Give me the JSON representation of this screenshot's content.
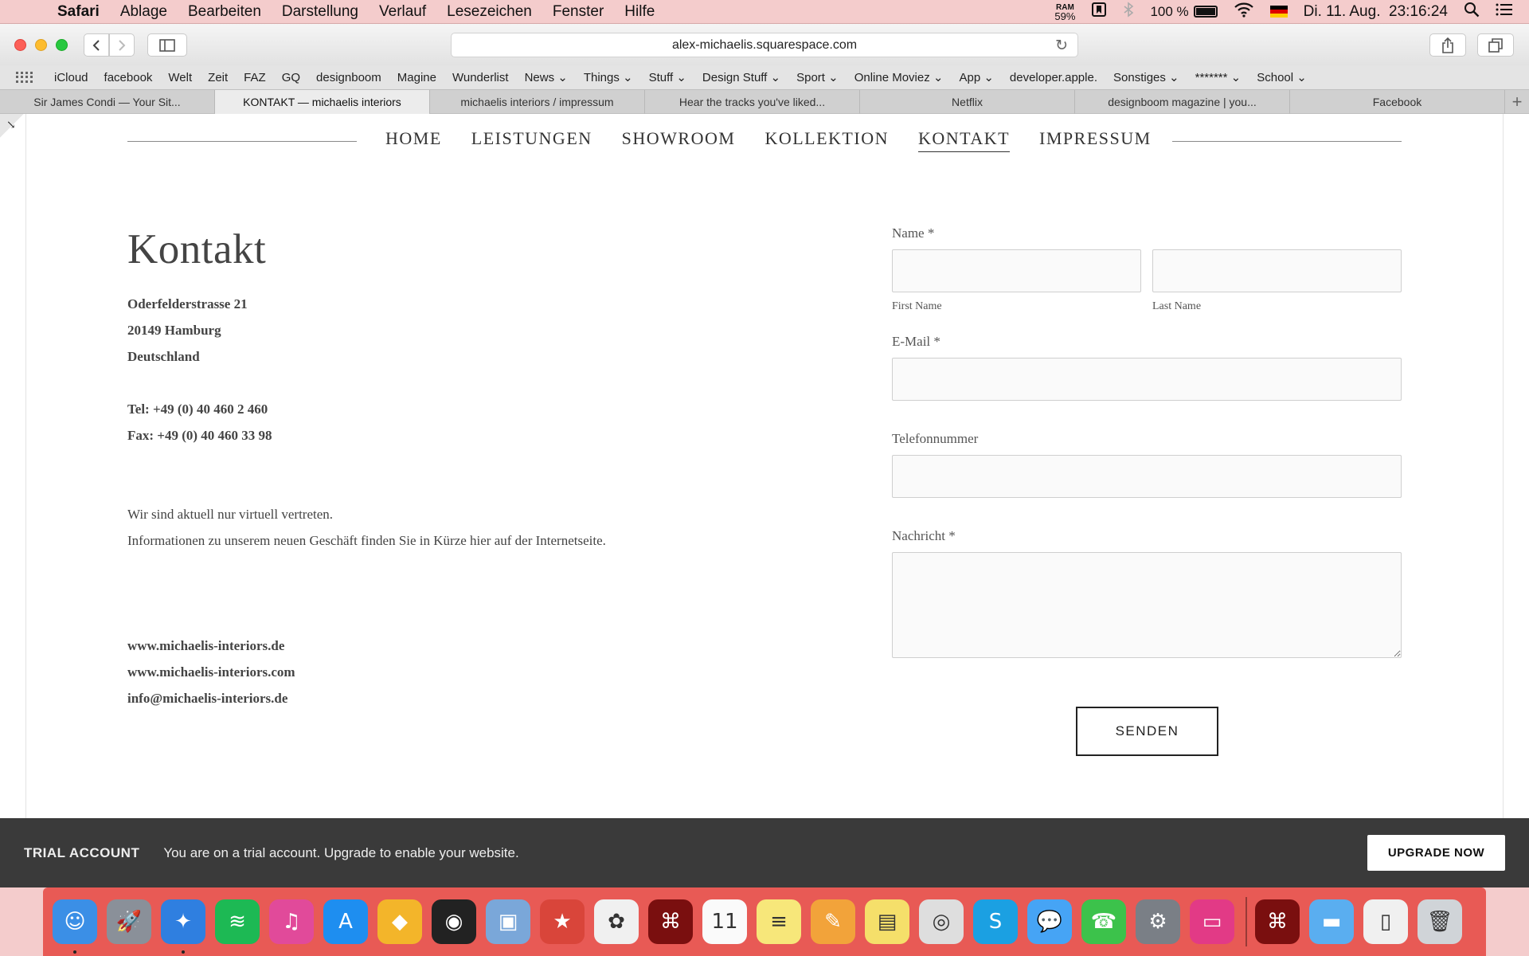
{
  "menubar": {
    "app": "Safari",
    "items": [
      "Ablage",
      "Bearbeiten",
      "Darstellung",
      "Verlauf",
      "Lesezeichen",
      "Fenster",
      "Hilfe"
    ],
    "ram_label": "RAM",
    "ram_value": "59%",
    "battery": "100 %",
    "datetime": "Di. 11. Aug.  23:16:24"
  },
  "toolbar": {
    "url": "alex-michaelis.squarespace.com"
  },
  "bookmarks": [
    "iCloud",
    "facebook",
    "Welt",
    "Zeit",
    "FAZ",
    "GQ",
    "designboom",
    "Magine",
    "Wunderlist",
    "News ⌄",
    "Things ⌄",
    "Stuff ⌄",
    "Design Stuff ⌄",
    "Sport ⌄",
    "Online Moviez ⌄",
    "App ⌄",
    "developer.apple.",
    "Sonstiges ⌄",
    "******* ⌄",
    "School ⌄"
  ],
  "tabs": [
    {
      "label": "Sir James Condi — Your Sit...",
      "active": false
    },
    {
      "label": "KONTAKT — michaelis interiors",
      "active": true
    },
    {
      "label": "michaelis interiors / impressum",
      "active": false
    },
    {
      "label": "Hear the tracks you've liked...",
      "active": false
    },
    {
      "label": "Netflix",
      "active": false
    },
    {
      "label": "designboom magazine | you...",
      "active": false
    },
    {
      "label": "Facebook",
      "active": false
    }
  ],
  "site": {
    "nav": [
      "HOME",
      "LEISTUNGEN",
      "SHOWROOM",
      "KOLLEKTION",
      "KONTAKT",
      "IMPRESSUM"
    ],
    "nav_current": "KONTAKT",
    "heading": "Kontakt",
    "address": [
      "Oderfelderstrasse 21",
      "20149 Hamburg",
      "Deutschland"
    ],
    "tel": "Tel: +49 (0) 40 460 2 460",
    "fax": "Fax: +49 (0) 40 460 33 98",
    "notice_1": "Wir sind aktuell nur virtuell vertreten.",
    "notice_2": "Informationen zu unserem neuen Geschäft finden Sie in Kürze hier auf der Internetseite.",
    "links": [
      "www.michaelis-interiors.de",
      "www.michaelis-interiors.com",
      "info@michaelis-interiors.de"
    ]
  },
  "form": {
    "name_label": "Name *",
    "first_name_label": "First Name",
    "last_name_label": "Last Name",
    "email_label": "E-Mail *",
    "phone_label": "Telefonnummer",
    "message_label": "Nachricht *",
    "submit": "SENDEN"
  },
  "trial": {
    "title": "TRIAL ACCOUNT",
    "message": "You are on a trial account. Upgrade to enable your website.",
    "button": "UPGRADE NOW"
  },
  "dock": [
    {
      "name": "finder-icon",
      "glyph": "☺",
      "color": "#3b8fe6",
      "running": true
    },
    {
      "name": "launchpad-icon",
      "glyph": "🚀",
      "color": "#8a9099",
      "running": false
    },
    {
      "name": "safari-icon",
      "glyph": "✦",
      "color": "#2f7fe0",
      "running": true
    },
    {
      "name": "spotify-icon",
      "glyph": "≋",
      "color": "#1db954",
      "running": false
    },
    {
      "name": "itunes-icon",
      "glyph": "♫",
      "color": "#e14a9a",
      "running": false
    },
    {
      "name": "app-store-icon",
      "glyph": "A",
      "color": "#1e8ef0",
      "running": false
    },
    {
      "name": "sketch-icon",
      "glyph": "◆",
      "color": "#f3b52a",
      "running": false
    },
    {
      "name": "photo-booth-icon",
      "glyph": "◉",
      "color": "#222",
      "running": false
    },
    {
      "name": "preview-icon",
      "glyph": "▣",
      "color": "#7aa7d9",
      "running": false
    },
    {
      "name": "wunderlist-icon",
      "glyph": "★",
      "color": "#d9453a",
      "running": false
    },
    {
      "name": "photos-icon",
      "glyph": "✿",
      "color": "#f0f0f0",
      "running": false
    },
    {
      "name": "acrobat-icon",
      "glyph": "⌘",
      "color": "#7a0f0f",
      "running": false
    },
    {
      "name": "calendar-icon",
      "glyph": "11",
      "color": "#fafafa",
      "running": false
    },
    {
      "name": "notes-icon",
      "glyph": "≡",
      "color": "#f7e77a",
      "running": false
    },
    {
      "name": "pages-icon",
      "glyph": "✎",
      "color": "#f2a33a",
      "running": false
    },
    {
      "name": "stickies-icon",
      "glyph": "▤",
      "color": "#f5df6a",
      "running": false
    },
    {
      "name": "dvd-player-icon",
      "glyph": "◎",
      "color": "#dedede",
      "running": false
    },
    {
      "name": "skype-icon",
      "glyph": "S",
      "color": "#1ba0e2",
      "running": false
    },
    {
      "name": "messages-icon",
      "glyph": "💬",
      "color": "#46a4f5",
      "running": false
    },
    {
      "name": "facetime-icon",
      "glyph": "☎",
      "color": "#3cc24b",
      "running": false
    },
    {
      "name": "system-preferences-icon",
      "glyph": "⚙",
      "color": "#7a7f86",
      "running": false
    },
    {
      "name": "cleanmymac-icon",
      "glyph": "▭",
      "color": "#e23a86",
      "running": false
    },
    {
      "name": "acrobat-reader-icon",
      "glyph": "⌘",
      "color": "#7a0f0f",
      "running": false
    },
    {
      "name": "downloads-folder-icon",
      "glyph": "▬",
      "color": "#5aaef0",
      "running": false
    },
    {
      "name": "file-icon",
      "glyph": "▯",
      "color": "#f0f0f0",
      "running": false
    },
    {
      "name": "trash-icon",
      "glyph": "🗑",
      "color": "#d0d4d8",
      "running": false
    }
  ]
}
